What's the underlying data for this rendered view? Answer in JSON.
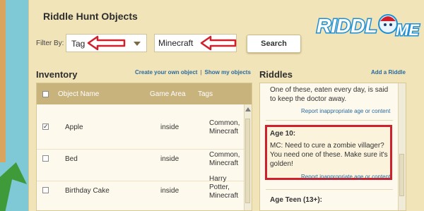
{
  "page": {
    "title": "Riddle Hunt Objects"
  },
  "logo": {
    "text": "RIDDLE ME"
  },
  "filter": {
    "label": "Filter By:",
    "select_value": "Tag",
    "input_value": "Minecraft",
    "search_label": "Search"
  },
  "inventory": {
    "heading": "Inventory",
    "create_link": "Create your own object",
    "show_link": "Show my objects",
    "separator": "|",
    "columns": {
      "name": "Object Name",
      "area": "Game Area",
      "tags": "Tags"
    },
    "rows": [
      {
        "checked": true,
        "name": "Apple",
        "area": "inside",
        "tags_lines": [
          "Common,",
          "Minecraft"
        ]
      },
      {
        "checked": false,
        "name": "Bed",
        "area": "inside",
        "tags_lines": [
          "Common,",
          "Minecraft"
        ]
      },
      {
        "checked": false,
        "name": "Birthday Cake",
        "area": "inside",
        "tags_lines": [
          "Harry",
          "Potter,",
          "Minecraft"
        ]
      }
    ]
  },
  "riddles": {
    "heading": "Riddles",
    "add_link": "Add a Riddle",
    "items": [
      {
        "text": "One of these, eaten every day, is said to keep the doctor away.",
        "report": "Report inappropriate age or content"
      },
      {
        "age": "Age 10:",
        "text": "MC: Need to cure a zombie villager? You need one of these. Make sure it's golden!",
        "report": "Report inappropriate age or content"
      },
      {
        "age": "Age Teen (13+):"
      }
    ]
  },
  "colors": {
    "accent_red": "#d0202b",
    "link_blue": "#2a6aa0",
    "table_header": "#c8b37d"
  }
}
